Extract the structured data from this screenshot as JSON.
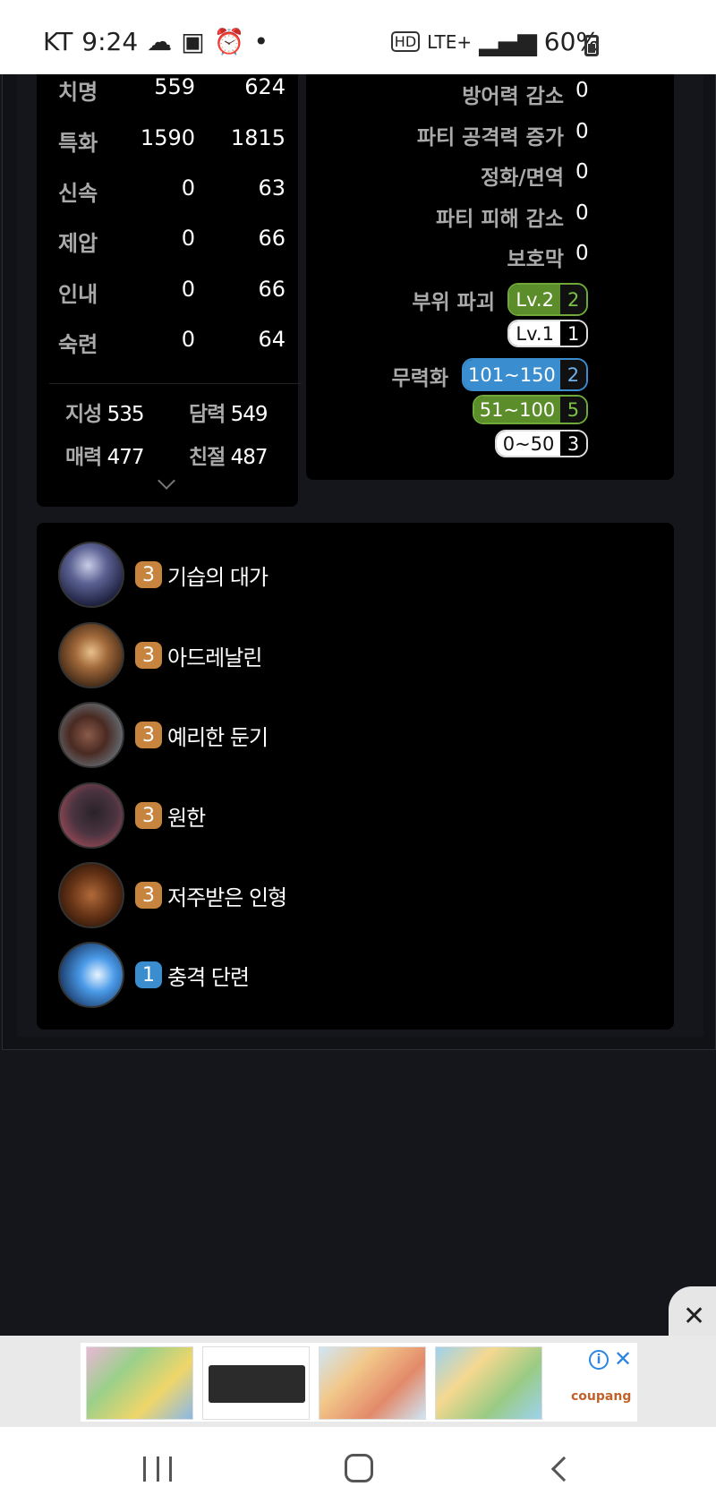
{
  "status_bar": {
    "carrier": "KT",
    "time": "9:24",
    "network": "LTE+",
    "battery": "60%"
  },
  "stats": {
    "rows": [
      {
        "name": "치명",
        "base": "559",
        "total": "624"
      },
      {
        "name": "특화",
        "base": "1590",
        "total": "1815"
      },
      {
        "name": "신속",
        "base": "0",
        "total": "63"
      },
      {
        "name": "제압",
        "base": "0",
        "total": "66"
      },
      {
        "name": "인내",
        "base": "0",
        "total": "66"
      },
      {
        "name": "숙련",
        "base": "0",
        "total": "64"
      }
    ],
    "attributes": [
      {
        "name": "지성",
        "value": "535"
      },
      {
        "name": "담력",
        "value": "549"
      },
      {
        "name": "매력",
        "value": "477"
      },
      {
        "name": "친절",
        "value": "487"
      }
    ]
  },
  "effects": {
    "rows": [
      {
        "name": "방어력 감소",
        "value": "0"
      },
      {
        "name": "파티 공격력 증가",
        "value": "0"
      },
      {
        "name": "정화/면역",
        "value": "0"
      },
      {
        "name": "파티 피해 감소",
        "value": "0"
      },
      {
        "name": "보호막",
        "value": "0"
      }
    ],
    "part_break": {
      "label": "부위 파괴",
      "badges": [
        {
          "label": "Lv.2",
          "count": "2"
        },
        {
          "label": "Lv.1",
          "count": "1"
        }
      ]
    },
    "stagger": {
      "label": "무력화",
      "badges": [
        {
          "label": "101~150",
          "count": "2"
        },
        {
          "label": "51~100",
          "count": "5"
        },
        {
          "label": "0~50",
          "count": "3"
        }
      ]
    }
  },
  "engravings": [
    {
      "level": "3",
      "name": "기습의 대가",
      "icon": "hooded-figure-icon",
      "color": "#c6843e"
    },
    {
      "level": "3",
      "name": "아드레날린",
      "icon": "burst-figure-icon",
      "color": "#c6843e"
    },
    {
      "level": "3",
      "name": "예리한 둔기",
      "icon": "spiked-mace-icon",
      "color": "#c6843e"
    },
    {
      "level": "3",
      "name": "원한",
      "icon": "beast-head-icon",
      "color": "#c6843e"
    },
    {
      "level": "3",
      "name": "저주받은 인형",
      "icon": "cursed-doll-icon",
      "color": "#c6843e"
    },
    {
      "level": "1",
      "name": "충격 단련",
      "icon": "energy-fighter-icon",
      "color": "#3a8ed0"
    }
  ],
  "ad": {
    "brand": "coupang"
  }
}
